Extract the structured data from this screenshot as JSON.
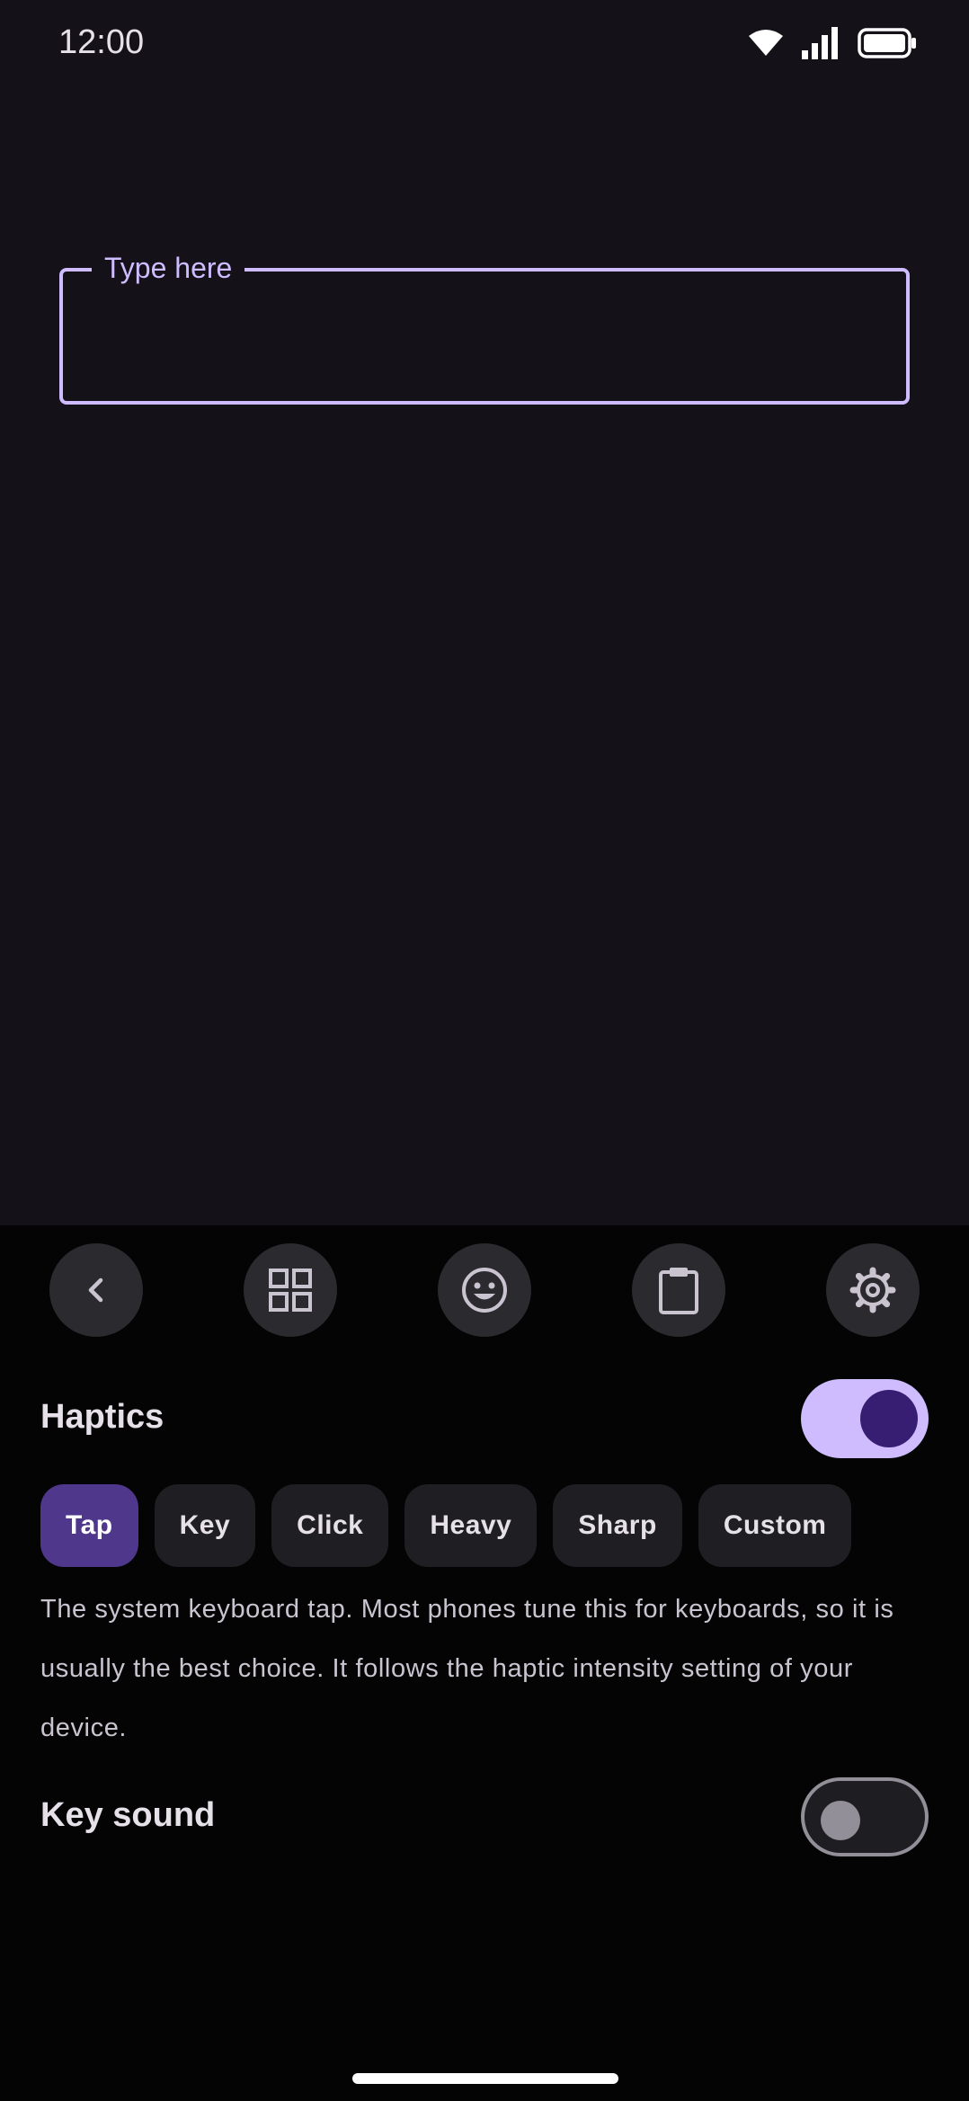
{
  "status_bar": {
    "time": "12:00",
    "icons": [
      "wifi-icon",
      "signal-icon",
      "battery-icon"
    ]
  },
  "text_field": {
    "label": "Type here",
    "value": "",
    "accent_color": "#cfbcff"
  },
  "toolbar": {
    "buttons": [
      {
        "name": "back-button",
        "icon": "chevron-left-icon"
      },
      {
        "name": "layout-button",
        "icon": "grid-icon"
      },
      {
        "name": "emoji-button",
        "icon": "emoji-icon"
      },
      {
        "name": "clipboard-button",
        "icon": "clipboard-icon"
      },
      {
        "name": "settings-button",
        "icon": "gear-icon"
      }
    ]
  },
  "settings": {
    "haptics": {
      "label": "Haptics",
      "enabled": true,
      "options": [
        "Tap",
        "Key",
        "Click",
        "Heavy",
        "Sharp",
        "Custom"
      ],
      "selected": "Tap",
      "description": "The system keyboard tap. Most phones tune this for keyboards, so it is usually the best choice. It follows the haptic intensity setting of your device."
    },
    "key_sound": {
      "label": "Key sound",
      "enabled": false
    }
  },
  "colors": {
    "background": "#141218",
    "keyboard_background": "#040405",
    "selected_chip": "#4f378b",
    "switch_on_track": "#cfbcff",
    "switch_on_thumb": "#381e72"
  }
}
